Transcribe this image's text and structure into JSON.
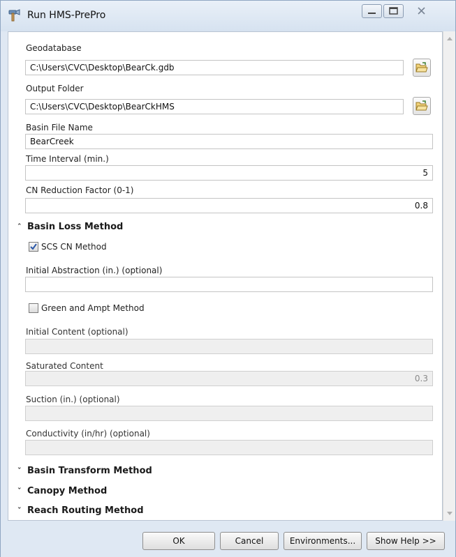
{
  "window": {
    "title": "Run HMS-PrePro",
    "icon": "hammer-tool-icon"
  },
  "form": {
    "geodatabase": {
      "label": "Geodatabase",
      "value": "C:\\Users\\CVC\\Desktop\\BearCk.gdb"
    },
    "output_folder": {
      "label": "Output Folder",
      "value": "C:\\Users\\CVC\\Desktop\\BearCkHMS"
    },
    "basin_file_name": {
      "label": "Basin File Name",
      "value": "BearCreek"
    },
    "time_interval": {
      "label": "Time Interval (min.)",
      "value": "5"
    },
    "cn_reduction": {
      "label": "CN Reduction Factor (0-1)",
      "value": "0.8"
    },
    "basin_loss": {
      "title": "Basin Loss Method",
      "expanded": true,
      "scs_cn": {
        "label": "SCS CN Method",
        "checked": true
      },
      "initial_abstraction": {
        "label": "Initial Abstraction (in.) (optional)",
        "value": ""
      },
      "green_ampt": {
        "label": "Green and Ampt Method",
        "checked": false
      },
      "initial_content": {
        "label": "Initial Content (optional)",
        "value": ""
      },
      "saturated_content": {
        "label": "Saturated Content",
        "value": "0.3"
      },
      "suction": {
        "label": "Suction (in.) (optional)",
        "value": ""
      },
      "conductivity": {
        "label": "Conductivity (in/hr) (optional)",
        "value": ""
      }
    },
    "collapsed_sections": [
      {
        "title": "Basin Transform Method"
      },
      {
        "title": "Canopy Method"
      },
      {
        "title": "Reach Routing Method"
      }
    ]
  },
  "buttons": {
    "ok": "OK",
    "cancel": "Cancel",
    "environments": "Environments...",
    "show_help": "Show Help >>"
  }
}
